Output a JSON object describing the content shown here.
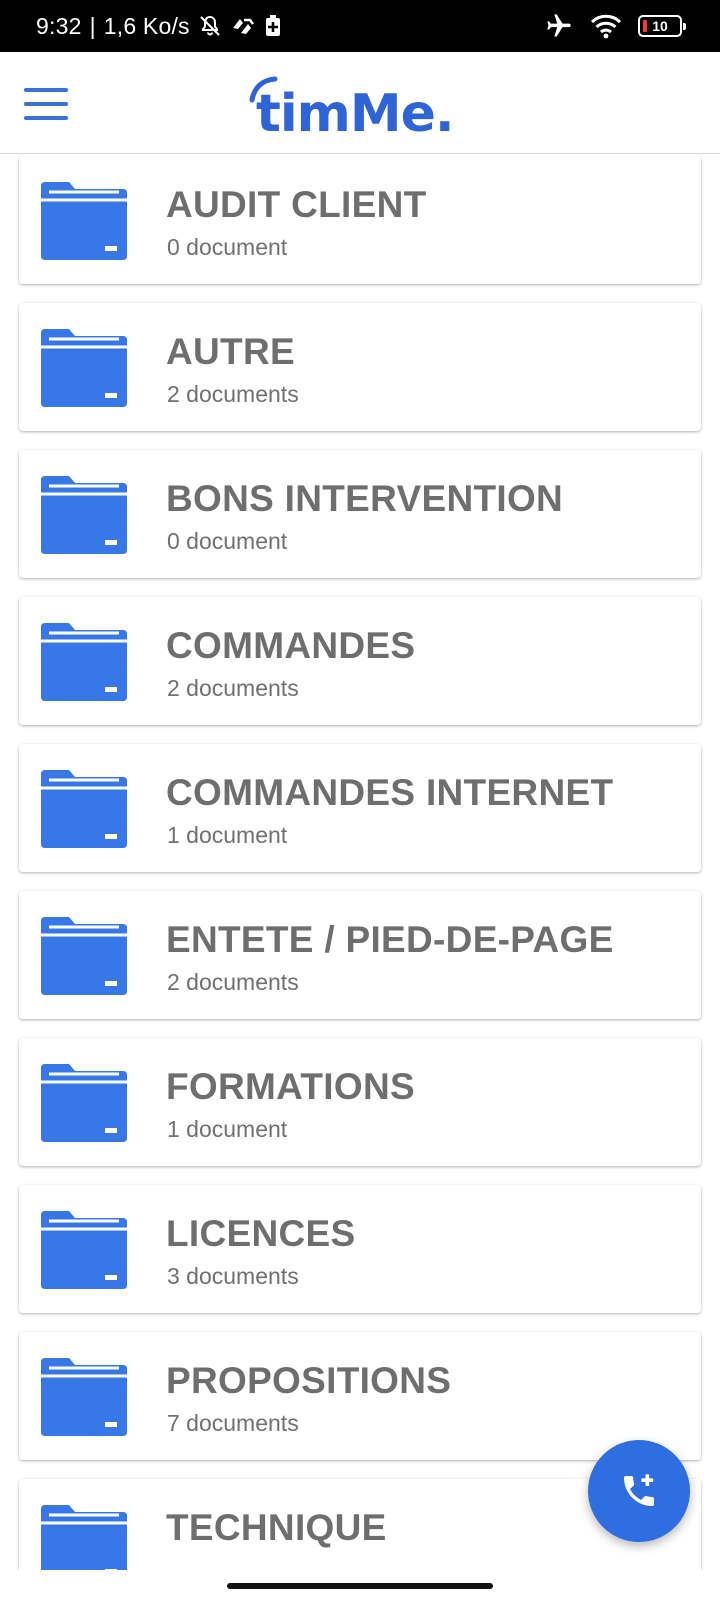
{
  "status_bar": {
    "time": "9:32",
    "separator": "|",
    "speed": "1,6 Ko/s",
    "icons": [
      "mute-icon",
      "sync-icon",
      "battery-saver-icon",
      "airplane-icon",
      "wifi-icon",
      "battery-icon"
    ],
    "battery_level": "10"
  },
  "app_bar": {
    "logo_text": "timMe.",
    "menu_icon": "hamburger-menu-icon"
  },
  "folders": [
    {
      "name": "AUDIT CLIENT",
      "count": "0 document"
    },
    {
      "name": "AUTRE",
      "count": "2 documents"
    },
    {
      "name": "BONS INTERVENTION",
      "count": "0 document"
    },
    {
      "name": "COMMANDES",
      "count": "2 documents"
    },
    {
      "name": "COMMANDES INTERNET",
      "count": "1 document"
    },
    {
      "name": "ENTETE / PIED-DE-PAGE",
      "count": "2 documents"
    },
    {
      "name": "FORMATIONS",
      "count": "1 document"
    },
    {
      "name": "LICENCES",
      "count": "3 documents"
    },
    {
      "name": "PROPOSITIONS",
      "count": "7 documents"
    },
    {
      "name": "TECHNIQUE",
      "count": ""
    }
  ],
  "fab": {
    "icon": "add-call-icon"
  },
  "colors": {
    "accent": "#2f6ee0",
    "folder": "#3777e6",
    "title_text": "#6e6e6e",
    "sub_text": "#707070"
  }
}
